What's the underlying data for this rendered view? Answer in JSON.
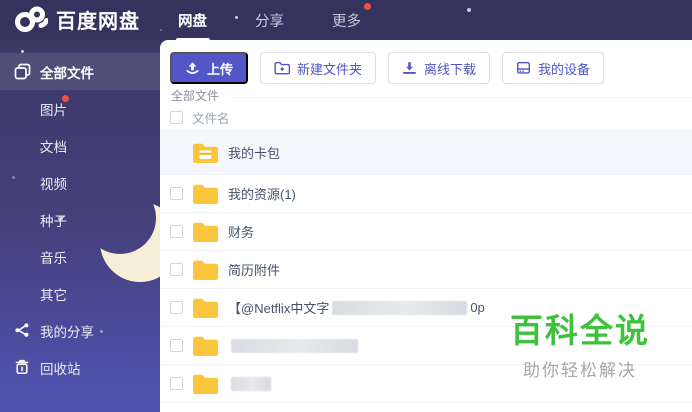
{
  "header": {
    "logo_text": "百度网盘",
    "logo_icon": "baidu-pan-cloud-icon",
    "nav": [
      {
        "label": "网盘",
        "active": true
      },
      {
        "label": "分享",
        "active": false
      },
      {
        "label": "更多",
        "active": false,
        "badge": true
      }
    ]
  },
  "sidebar": {
    "items": [
      {
        "label": "全部文件",
        "icon": "files-icon",
        "active": true
      },
      {
        "label": "图片",
        "badge": true
      },
      {
        "label": "文档"
      },
      {
        "label": "视频"
      },
      {
        "label": "种子"
      },
      {
        "label": "音乐"
      },
      {
        "label": "其它"
      },
      {
        "label": "我的分享",
        "icon": "share-icon"
      },
      {
        "label": "回收站",
        "icon": "trash-icon"
      }
    ]
  },
  "toolbar": {
    "upload_label": "上传",
    "new_folder_label": "新建文件夹",
    "offline_download_label": "离线下载",
    "my_devices_label": "我的设备"
  },
  "breadcrumb": "全部文件",
  "table": {
    "name_header": "文件名",
    "rows": [
      {
        "name": "我的卡包",
        "icon": "folder-card-icon",
        "hover": true,
        "no_checkbox": true
      },
      {
        "name": "我的资源(1)",
        "icon": "folder-icon"
      },
      {
        "name": "财务",
        "icon": "folder-icon"
      },
      {
        "name": "简历附件",
        "icon": "folder-icon"
      },
      {
        "name_prefix": "【@Netflix中文字",
        "censored_width": 135,
        "name_suffix": "0p",
        "icon": "folder-icon"
      },
      {
        "name_prefix": "",
        "censored_width": 127,
        "name_suffix": "",
        "icon": "folder-icon"
      },
      {
        "name_prefix": "",
        "censored_width": 40,
        "name_suffix": "",
        "icon": "folder-icon"
      }
    ]
  },
  "watermark": {
    "title": "百科全说",
    "subtitle": "助你轻松解决"
  },
  "colors": {
    "accent_purple": "#5356C6",
    "header_bg": "#36325E",
    "sidebar_top": "#3C3866",
    "sidebar_bottom": "#5053B2",
    "folder_yellow": "#FBC63E",
    "badge_red": "#F4503F",
    "watermark_green": "#3EC23B"
  }
}
